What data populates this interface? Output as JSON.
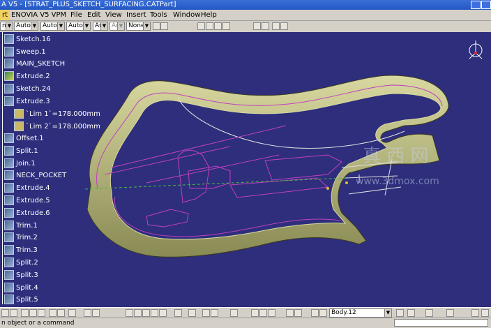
{
  "window": {
    "title": "A V5 - [STRAT_PLUS_SKETCH_SURFACING.CATPart]"
  },
  "menu": {
    "highlighted": "rt",
    "items": [
      "ENOVIA V5 VPM",
      "File",
      "Edit",
      "View",
      "Insert",
      "Tools",
      "Window",
      "Help"
    ]
  },
  "toolbar": {
    "combos": [
      "ma",
      "Auto",
      "Auto",
      "Auto",
      "Aut",
      "Aut",
      "None"
    ]
  },
  "tree": {
    "items": [
      {
        "label": "Sketch.16"
      },
      {
        "label": "Sweep.1"
      },
      {
        "label": "MAIN_SKETCH"
      },
      {
        "label": "Extrude.2"
      },
      {
        "label": "Sketch.24"
      },
      {
        "label": "Extrude.3"
      },
      {
        "label": "`Lim 1`=178.000mm"
      },
      {
        "label": "`Lim 2`=178.000mm"
      },
      {
        "label": "Offset.1"
      },
      {
        "label": "Split.1"
      },
      {
        "label": "Join.1"
      },
      {
        "label": "NECK_POCKET"
      },
      {
        "label": "Extrude.4"
      },
      {
        "label": "Extrude.5"
      },
      {
        "label": "Extrude.6"
      },
      {
        "label": "Trim.1"
      },
      {
        "label": "Trim.2"
      },
      {
        "label": "Trim.3"
      },
      {
        "label": "Split.2"
      },
      {
        "label": "Split.3"
      },
      {
        "label": "Split.4"
      },
      {
        "label": "Split.5"
      }
    ]
  },
  "bottom_toolbar": {
    "body_combo": "Body.12"
  },
  "status": {
    "message": "n object or a command"
  },
  "watermark": {
    "chinese": "真 西 网",
    "url": "www.3dmox.com"
  },
  "colors": {
    "viewport_bg": "#2e2e7c",
    "surface": "#b8b880",
    "sketch_line": "#c040c0"
  },
  "icons": [
    "compass-icon",
    "part-icon",
    "sketch-icon",
    "extrude-icon",
    "split-icon"
  ]
}
